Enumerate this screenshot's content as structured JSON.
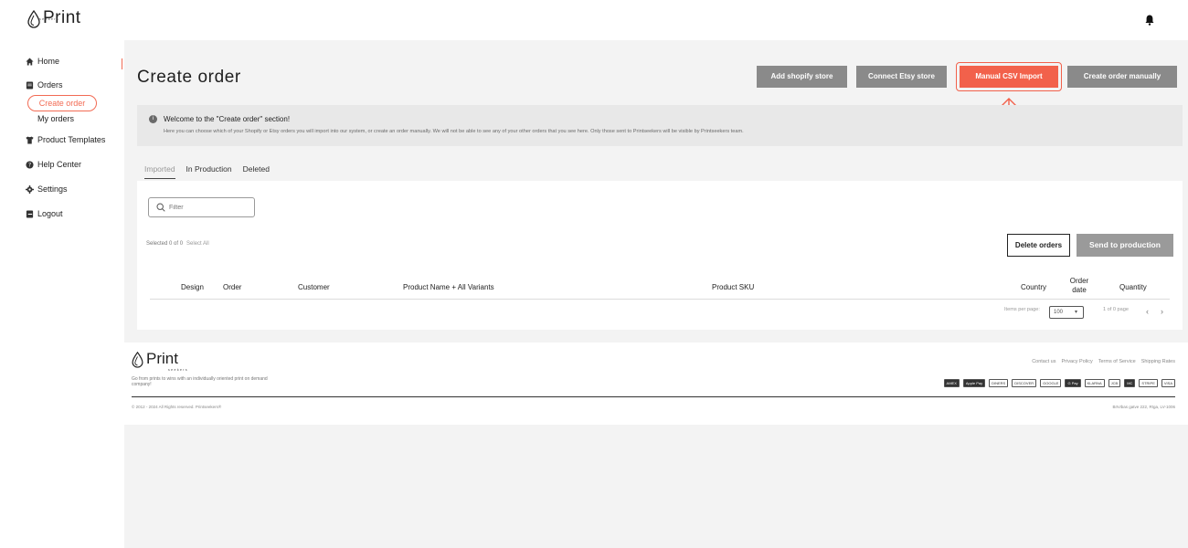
{
  "brand": {
    "name": "Print",
    "sub": "seekers"
  },
  "sidebar": {
    "items": [
      {
        "label": "Home",
        "icon": "home-icon"
      },
      {
        "label": "Orders",
        "icon": "orders-icon"
      },
      {
        "label": "Product Templates",
        "icon": "shirt-icon"
      },
      {
        "label": "Help Center",
        "icon": "help-icon"
      },
      {
        "label": "Settings",
        "icon": "gear-icon"
      },
      {
        "label": "Logout",
        "icon": "logout-icon"
      }
    ],
    "orders_sub": [
      {
        "label": "Create order",
        "active": true
      },
      {
        "label": "My orders",
        "active": false
      }
    ]
  },
  "header": {
    "title": "Create order",
    "buttons": {
      "shopify": "Add shopify store",
      "etsy": "Connect Etsy store",
      "csv": "Manual CSV Import",
      "manual": "Create order manually"
    }
  },
  "welcome": {
    "title": "Welcome to the \"Create order\" section!",
    "text": "Here you can choose which of your Shopify or Etsy orders you will import into our system, or create an order manually. We will not be able to see any of your other orders that you see here. Only those sent to Printseekers will be visible by Printseekers team."
  },
  "tabs": [
    "Imported",
    "In Production",
    "Deleted"
  ],
  "filter": {
    "placeholder": "Filter"
  },
  "selection": {
    "text": "Selected 0 of 0",
    "select_all": "Select All"
  },
  "actions": {
    "delete": "Delete orders",
    "send": "Send to production"
  },
  "table": {
    "columns": [
      "Design",
      "Order",
      "Customer",
      "Product Name + All Variants",
      "Product SKU",
      "Country",
      "Order date",
      "Quantity"
    ]
  },
  "pagination": {
    "items_label": "Items per page:",
    "per_page": "100",
    "page_info": "1 of 0 page"
  },
  "footer": {
    "tagline": "Go from prints to wins with an individually oriented print on demand company!",
    "links": [
      "Contact us",
      "Privacy Policy",
      "Terms of Service",
      "Shipping Rates"
    ],
    "copyright": "© 2012 - 2024 All Rights reserved. Printseekers®",
    "address": "Brīvības gatve 222, Rīga, LV-1006",
    "payments": [
      "AMEX",
      "Apple Pay",
      "DINERS",
      "DISCOVER",
      "GOOGLE",
      "G Pay",
      "KLARNA",
      "JCB",
      "MC",
      "STRIPE",
      "VISA"
    ]
  },
  "colors": {
    "accent": "#f2614b",
    "button_gray": "#8a8a8a"
  }
}
